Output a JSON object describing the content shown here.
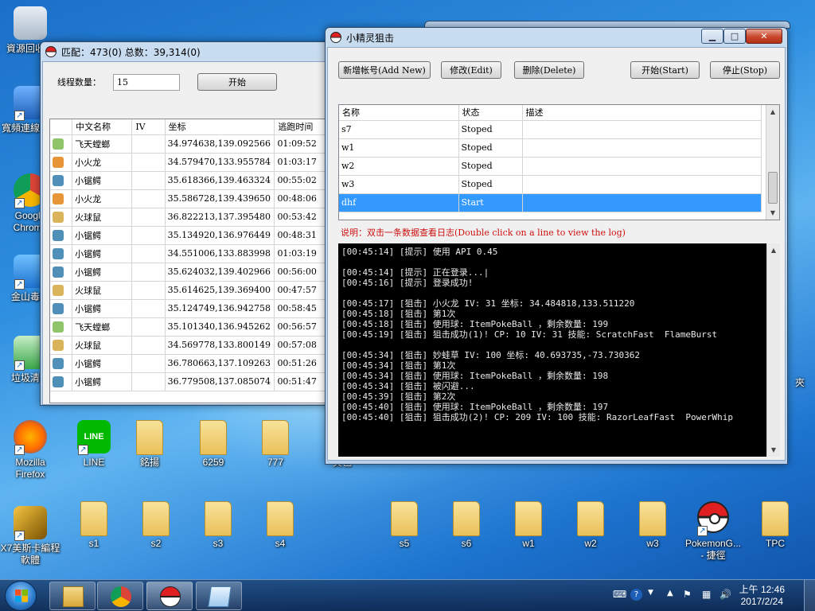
{
  "desktop": {
    "icons_left": [
      {
        "label": "資源回收筒",
        "icon": "recycle-bin-icon"
      },
      {
        "label": "寬頻連線捷徑",
        "icon": "network-connection-icon"
      },
      {
        "label": "Google Chrome",
        "icon": "chrome-icon"
      },
      {
        "label": "金山毒霸",
        "icon": "antivirus-icon"
      },
      {
        "label": "垃圾清理",
        "icon": "cleaner-icon"
      },
      {
        "label": "Mozilla Firefox",
        "icon": "firefox-icon"
      },
      {
        "label": "X7美斯卡編程軟體",
        "icon": "x7-icon"
      }
    ],
    "row1": [
      {
        "label": "LINE",
        "icon": "line-icon"
      },
      {
        "label": "銘揚",
        "icon": "folder-icon"
      },
      {
        "label": "6259",
        "icon": "folder-icon"
      },
      {
        "label": "777",
        "icon": "folder-icon"
      },
      {
        "label": "黃色",
        "icon": "folder-icon"
      }
    ],
    "row2": [
      {
        "label": "s1",
        "icon": "folder-icon"
      },
      {
        "label": "s2",
        "icon": "folder-icon"
      },
      {
        "label": "s3",
        "icon": "folder-icon"
      },
      {
        "label": "s4",
        "icon": "folder-icon"
      },
      {
        "label": "s5",
        "icon": "folder-icon"
      },
      {
        "label": "s6",
        "icon": "folder-icon"
      },
      {
        "label": "w1",
        "icon": "folder-icon"
      },
      {
        "label": "w2",
        "icon": "folder-icon"
      },
      {
        "label": "w3",
        "icon": "folder-icon"
      },
      {
        "label": "PokemonG... - 捷徑",
        "icon": "pokeball-icon"
      },
      {
        "label": "TPC",
        "icon": "folder-icon"
      }
    ],
    "right_edge_label": "夾"
  },
  "left_window": {
    "title": "匹配：473(0) 总数：39,314(0)",
    "thread_label": "线程数量：",
    "thread_value": "15",
    "start_button": "开始",
    "columns": [
      "中文名称",
      "IV",
      "坐标",
      "逃跑时间"
    ],
    "rows": [
      {
        "name": "飞天螳螂",
        "iv": "",
        "coord": "34.974638,139.092566",
        "time": "01:09:52",
        "color": "#8fc46a"
      },
      {
        "name": "小火龙",
        "iv": "",
        "coord": "34.579470,133.955784",
        "time": "01:03:17",
        "color": "#e8953a"
      },
      {
        "name": "小锯鳄",
        "iv": "",
        "coord": "35.618366,139.463324",
        "time": "00:55:02",
        "color": "#4f8fb8"
      },
      {
        "name": "小火龙",
        "iv": "",
        "coord": "35.586728,139.439650",
        "time": "00:48:06",
        "color": "#e8953a"
      },
      {
        "name": "火球鼠",
        "iv": "",
        "coord": "36.822213,137.395480",
        "time": "00:53:42",
        "color": "#d9b45a"
      },
      {
        "name": "小锯鳄",
        "iv": "",
        "coord": "35.134920,136.976449",
        "time": "00:48:31",
        "color": "#4f8fb8"
      },
      {
        "name": "小锯鳄",
        "iv": "",
        "coord": "34.551006,133.883998",
        "time": "01:03:19",
        "color": "#4f8fb8"
      },
      {
        "name": "小锯鳄",
        "iv": "",
        "coord": "35.624032,139.402966",
        "time": "00:56:00",
        "color": "#4f8fb8"
      },
      {
        "name": "火球鼠",
        "iv": "",
        "coord": "35.614625,139.369400",
        "time": "00:47:57",
        "color": "#d9b45a"
      },
      {
        "name": "小锯鳄",
        "iv": "",
        "coord": "35.124749,136.942758",
        "time": "00:58:45",
        "color": "#4f8fb8"
      },
      {
        "name": "飞天螳螂",
        "iv": "",
        "coord": "35.101340,136.945262",
        "time": "00:56:57",
        "color": "#8fc46a"
      },
      {
        "name": "火球鼠",
        "iv": "",
        "coord": "34.569778,133.800149",
        "time": "00:57:08",
        "color": "#d9b45a"
      },
      {
        "name": "小锯鳄",
        "iv": "",
        "coord": "36.780663,137.109263",
        "time": "00:51:26",
        "color": "#4f8fb8"
      },
      {
        "name": "小锯鳄",
        "iv": "",
        "coord": "36.779508,137.085074",
        "time": "00:51:47",
        "color": "#4f8fb8"
      }
    ]
  },
  "right_window": {
    "title": "小精灵狙击",
    "buttons": {
      "add": "新增帐号(Add New)",
      "edit": "修改(Edit)",
      "delete": "删除(Delete)",
      "start": "开始(Start)",
      "stop": "停止(Stop)"
    },
    "columns": [
      "名称",
      "状态",
      "描述"
    ],
    "accounts": [
      {
        "name": "s7",
        "status": "Stoped",
        "desc": ""
      },
      {
        "name": "w1",
        "status": "Stoped",
        "desc": ""
      },
      {
        "name": "w2",
        "status": "Stoped",
        "desc": ""
      },
      {
        "name": "w3",
        "status": "Stoped",
        "desc": ""
      },
      {
        "name": "dhf",
        "status": "Start",
        "desc": ""
      }
    ],
    "note": "说明：双击一条数据查看日志(Double click on a line to view the log)",
    "log": "[00:45:14] [提示] 使用 API 0.45\n\n[00:45:14] [提示] 正在登录...|\n[00:45:16] [提示] 登录成功!\n\n[00:45:17] [狙击] 小火龙 IV: 31 坐标: 34.484818,133.511220\n[00:45:18] [狙击] 第1次\n[00:45:18] [狙击] 使用球: ItemPokeBall ，剩余数量: 199\n[00:45:19] [狙击] 狙击成功(1)! CP: 10 IV: 31 技能: ScratchFast  FlameBurst\n\n[00:45:34] [狙击] 妙蛙草 IV: 100 坐标: 40.693735,-73.730362\n[00:45:34] [狙击] 第1次\n[00:45:34] [狙击] 使用球: ItemPokeBall ，剩余数量: 198\n[00:45:34] [狙击] 被闪避...\n[00:45:39] [狙击] 第2次\n[00:45:40] [狙击] 使用球: ItemPokeBall ，剩余数量: 197\n[00:45:40] [狙击] 狙击成功(2)! CP: 209 IV: 100 技能: RazorLeafFast  PowerWhip",
    "minimize": "▁",
    "maximize": "□",
    "close": "✕"
  },
  "taskbar": {
    "clock_time": "上午 12:46",
    "clock_date": "2017/2/24"
  }
}
